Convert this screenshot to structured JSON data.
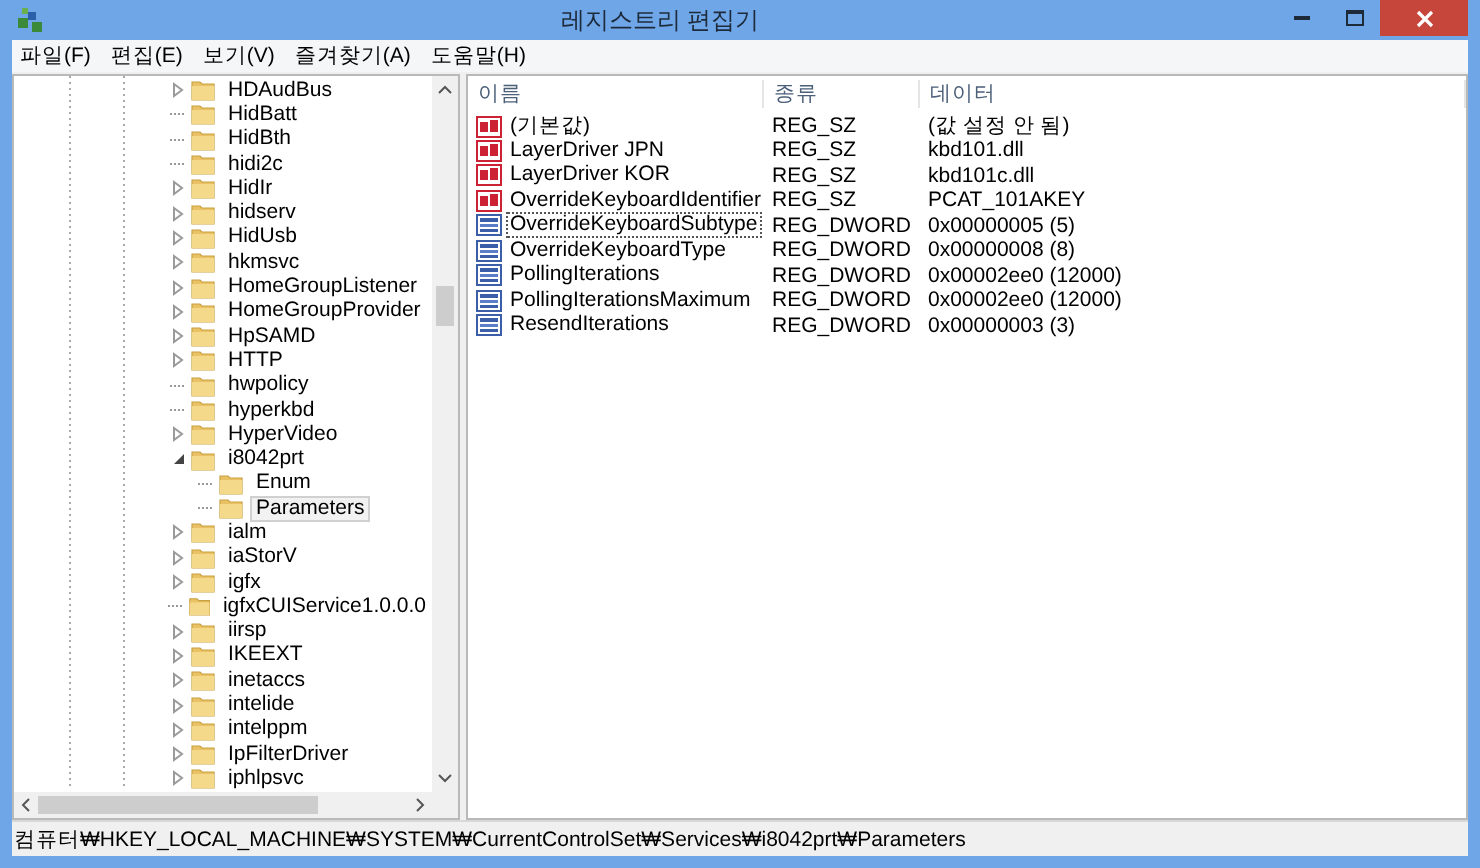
{
  "window": {
    "title": "레지스트리 편집기"
  },
  "menu": [
    "파일(F)",
    "편집(E)",
    "보기(V)",
    "즐겨찾기(A)",
    "도움말(H)"
  ],
  "tree": [
    {
      "label": "HDAudBus",
      "expandable": true,
      "expanded": false,
      "selected": false
    },
    {
      "label": "HidBatt",
      "expandable": false,
      "expanded": false,
      "selected": false
    },
    {
      "label": "HidBth",
      "expandable": false,
      "expanded": false,
      "selected": false
    },
    {
      "label": "hidi2c",
      "expandable": false,
      "expanded": false,
      "selected": false
    },
    {
      "label": "HidIr",
      "expandable": true,
      "expanded": false,
      "selected": false
    },
    {
      "label": "hidserv",
      "expandable": true,
      "expanded": false,
      "selected": false
    },
    {
      "label": "HidUsb",
      "expandable": true,
      "expanded": false,
      "selected": false
    },
    {
      "label": "hkmsvc",
      "expandable": true,
      "expanded": false,
      "selected": false
    },
    {
      "label": "HomeGroupListener",
      "expandable": true,
      "expanded": false,
      "selected": false
    },
    {
      "label": "HomeGroupProvider",
      "expandable": true,
      "expanded": false,
      "selected": false
    },
    {
      "label": "HpSAMD",
      "expandable": true,
      "expanded": false,
      "selected": false
    },
    {
      "label": "HTTP",
      "expandable": true,
      "expanded": false,
      "selected": false
    },
    {
      "label": "hwpolicy",
      "expandable": false,
      "expanded": false,
      "selected": false
    },
    {
      "label": "hyperkbd",
      "expandable": false,
      "expanded": false,
      "selected": false
    },
    {
      "label": "HyperVideo",
      "expandable": true,
      "expanded": false,
      "selected": false
    },
    {
      "label": "i8042prt",
      "expandable": true,
      "expanded": true,
      "selected": false,
      "children": [
        {
          "label": "Enum",
          "expandable": false,
          "expanded": false,
          "selected": false
        },
        {
          "label": "Parameters",
          "expandable": false,
          "expanded": false,
          "selected": true
        }
      ]
    },
    {
      "label": "ialm",
      "expandable": true,
      "expanded": false,
      "selected": false
    },
    {
      "label": "iaStorV",
      "expandable": true,
      "expanded": false,
      "selected": false
    },
    {
      "label": "igfx",
      "expandable": true,
      "expanded": false,
      "selected": false
    },
    {
      "label": "igfxCUIService1.0.0.0",
      "expandable": false,
      "expanded": false,
      "selected": false
    },
    {
      "label": "iirsp",
      "expandable": true,
      "expanded": false,
      "selected": false
    },
    {
      "label": "IKEEXT",
      "expandable": true,
      "expanded": false,
      "selected": false
    },
    {
      "label": "inetaccs",
      "expandable": true,
      "expanded": false,
      "selected": false
    },
    {
      "label": "intelide",
      "expandable": true,
      "expanded": false,
      "selected": false
    },
    {
      "label": "intelppm",
      "expandable": true,
      "expanded": false,
      "selected": false
    },
    {
      "label": "IpFilterDriver",
      "expandable": true,
      "expanded": false,
      "selected": false
    },
    {
      "label": "iphlpsvc",
      "expandable": true,
      "expanded": false,
      "selected": false
    }
  ],
  "table": {
    "columns": [
      "이름",
      "종류",
      "데이터"
    ],
    "rows": [
      {
        "kind": "string",
        "name": "(기본값)",
        "type": "REG_SZ",
        "data": "(값 설정 안 됨)",
        "focused": false
      },
      {
        "kind": "string",
        "name": "LayerDriver JPN",
        "type": "REG_SZ",
        "data": "kbd101.dll",
        "focused": false
      },
      {
        "kind": "string",
        "name": "LayerDriver KOR",
        "type": "REG_SZ",
        "data": "kbd101c.dll",
        "focused": false
      },
      {
        "kind": "string",
        "name": "OverrideKeyboardIdentifier",
        "type": "REG_SZ",
        "data": "PCAT_101AKEY",
        "focused": false
      },
      {
        "kind": "binary",
        "name": "OverrideKeyboardSubtype",
        "type": "REG_DWORD",
        "data": "0x00000005 (5)",
        "focused": true
      },
      {
        "kind": "binary",
        "name": "OverrideKeyboardType",
        "type": "REG_DWORD",
        "data": "0x00000008 (8)",
        "focused": false
      },
      {
        "kind": "binary",
        "name": "PollingIterations",
        "type": "REG_DWORD",
        "data": "0x00002ee0 (12000)",
        "focused": false
      },
      {
        "kind": "binary",
        "name": "PollingIterationsMaximum",
        "type": "REG_DWORD",
        "data": "0x00002ee0 (12000)",
        "focused": false
      },
      {
        "kind": "binary",
        "name": "ResendIterations",
        "type": "REG_DWORD",
        "data": "0x00000003 (3)",
        "focused": false
      }
    ]
  },
  "status_bar": "컴퓨터₩HKEY_LOCAL_MACHINE₩SYSTEM₩CurrentControlSet₩Services₩i8042prt₩Parameters"
}
